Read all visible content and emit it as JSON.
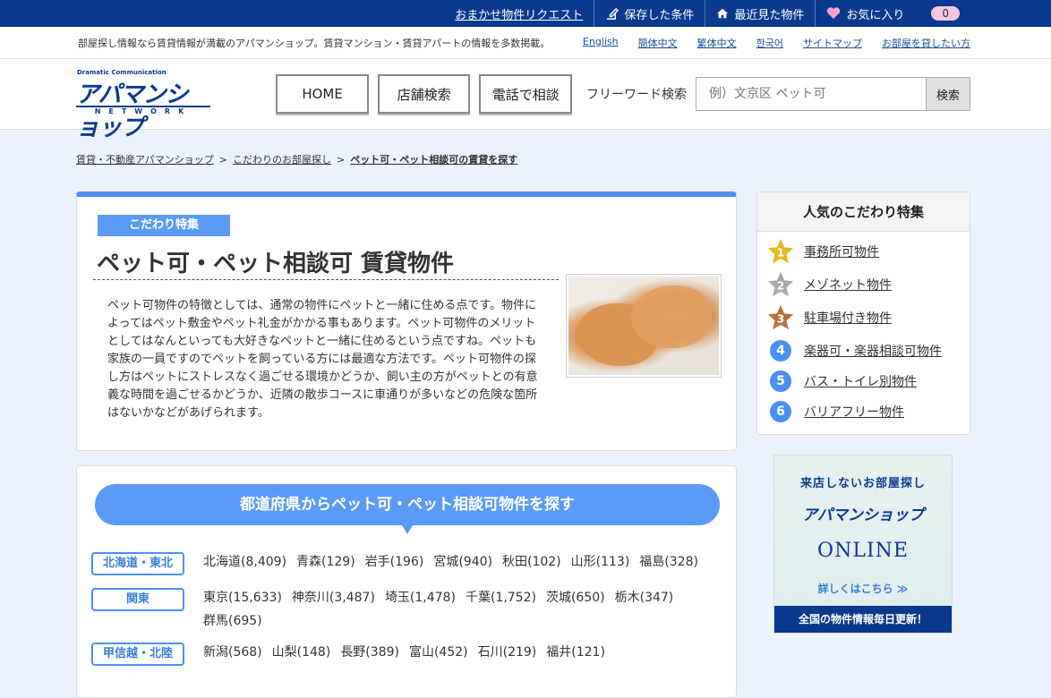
{
  "topbar": {
    "request": "おまかせ物件リクエスト",
    "saved": "保存した条件",
    "recent": "最近見た物件",
    "favorites": "お気に入り",
    "favorites_count": "0"
  },
  "subbar": {
    "tagline": "部屋探し情報なら賃貸情報が満載のアパマンショップ。賃貸マンション・賃貸アパートの情報を多数掲載。",
    "links": [
      "English",
      "簡体中文",
      "繁体中文",
      "한국어",
      "サイトマップ",
      "お部屋を貸したい方"
    ]
  },
  "header": {
    "logo_tag": "Dramatic Communication",
    "logo": "アパマンショップ",
    "logo_sub": "NETWORK",
    "nav_home": "HOME",
    "nav_store": "店舗検索",
    "nav_tel": "電話で相談",
    "freeword_label": "フリーワード検索",
    "search_placeholder": "例）文京区 ペット可",
    "search_button": "検索"
  },
  "breadcrumb": {
    "items": [
      "賃貸・不動産アパマンショップ",
      "こだわりのお部屋探し",
      "ペット可・ペット相談可の賃貸を探す"
    ],
    "separator": ">"
  },
  "feature": {
    "label": "こだわり特集",
    "title": "ペット可・ペット相談可 賃貸物件",
    "description": "ペット可物件の特徴としては、通常の物件にペットと一緒に住める点です。物件によってはペット敷金やペット礼金がかかる事もあります。ペット可物件のメリットとしてはなんといっても大好きなペットと一緒に住めるという点ですね。ペットも家族の一員ですのでペットを飼っている方には最適な方法です。ペット可物件の探し方はペットにストレスなく過ごせる環境かどうか、飼い主の方がペットとの有意義な時間を過ごせるかどうか、近隣の散歩コースに車通りが多いなどの危険な箇所はないかなどがあげられます。"
  },
  "regions": {
    "heading": "都道府県からペット可・ペット相談可物件を探す",
    "rows": [
      {
        "name": "北海道・東北",
        "prefs": [
          "北海道(8,409)",
          "青森(129)",
          "岩手(196)",
          "宮城(940)",
          "秋田(102)",
          "山形(113)",
          "福島(328)"
        ]
      },
      {
        "name": "関東",
        "prefs": [
          "東京(15,633)",
          "神奈川(3,487)",
          "埼玉(1,478)",
          "千葉(1,752)",
          "茨城(650)",
          "栃木(347)",
          "群馬(695)"
        ]
      },
      {
        "name": "甲信越・北陸",
        "prefs": [
          "新潟(568)",
          "山梨(148)",
          "長野(389)",
          "富山(452)",
          "石川(219)",
          "福井(121)"
        ]
      }
    ]
  },
  "sidebar": {
    "heading": "人気のこだわり特集",
    "items": [
      {
        "rank": "1",
        "label": "事務所可物件",
        "color": "#e8b820"
      },
      {
        "rank": "2",
        "label": "メゾネット物件",
        "color": "#a8a8a8"
      },
      {
        "rank": "3",
        "label": "駐車場付き物件",
        "color": "#b5743a"
      },
      {
        "rank": "4",
        "label": "楽器可・楽器相談可物件",
        "color": "#4a90f0"
      },
      {
        "rank": "5",
        "label": "バス・トイレ別物件",
        "color": "#4a90f0"
      },
      {
        "rank": "6",
        "label": "バリアフリー物件",
        "color": "#4a90f0"
      }
    ]
  },
  "banner": {
    "line1": "来店しないお部屋探し",
    "logo": "アパマンショップ",
    "online": "ONLINE",
    "detail": "詳しくはこちら ≫",
    "bottom": "全国の物件情報毎日更新！"
  },
  "colors": {
    "brand": "#0a3a8e",
    "accent": "#4a90f0",
    "background": "#ebf2fc"
  }
}
